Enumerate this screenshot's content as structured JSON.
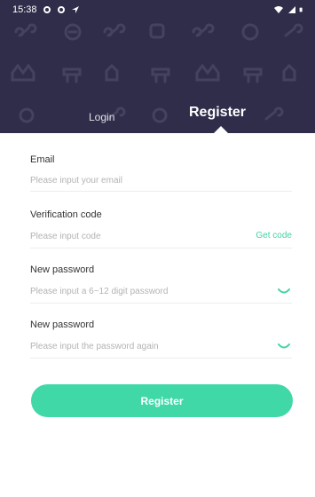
{
  "status_bar": {
    "time": "15:38"
  },
  "tabs": {
    "login_label": "Login",
    "register_label": "Register"
  },
  "form": {
    "email": {
      "label": "Email",
      "placeholder": "Please input your email"
    },
    "verification_code": {
      "label": "Verification code",
      "placeholder": "Please input code",
      "get_code_label": "Get code"
    },
    "new_password": {
      "label": "New password",
      "placeholder": "Please input a 6~12 digit password"
    },
    "confirm_password": {
      "label": "New password",
      "placeholder": "Please input the password again"
    }
  },
  "register_button_label": "Register",
  "colors": {
    "header_bg": "#2f2d4a",
    "accent": "#41d8a8",
    "link": "#41d3a6"
  },
  "icons": [
    "settings-icon",
    "navigation-icon",
    "wifi-icon",
    "signal-icon",
    "battery-icon",
    "eye-closed-icon"
  ]
}
